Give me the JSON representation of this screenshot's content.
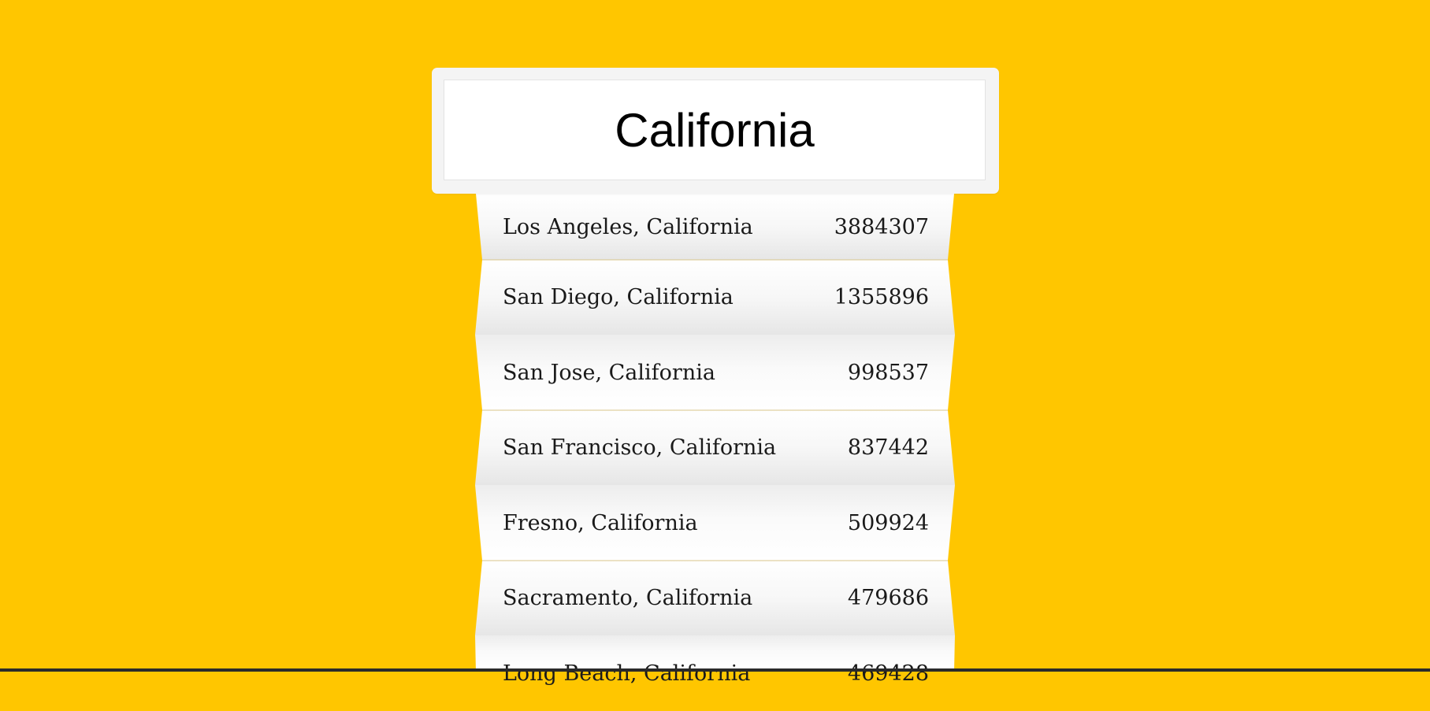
{
  "search": {
    "value": "California"
  },
  "results": [
    {
      "city": "Los Angeles, California",
      "population": "3884307"
    },
    {
      "city": "San Diego, California",
      "population": "1355896"
    },
    {
      "city": "San Jose, California",
      "population": "998537"
    },
    {
      "city": "San Francisco, California",
      "population": "837442"
    },
    {
      "city": "Fresno, California",
      "population": "509924"
    },
    {
      "city": "Sacramento, California",
      "population": "479686"
    },
    {
      "city": "Long Beach, California",
      "population": "469428"
    }
  ],
  "colors": {
    "background": "#ffc600",
    "card": "#ffffff"
  }
}
